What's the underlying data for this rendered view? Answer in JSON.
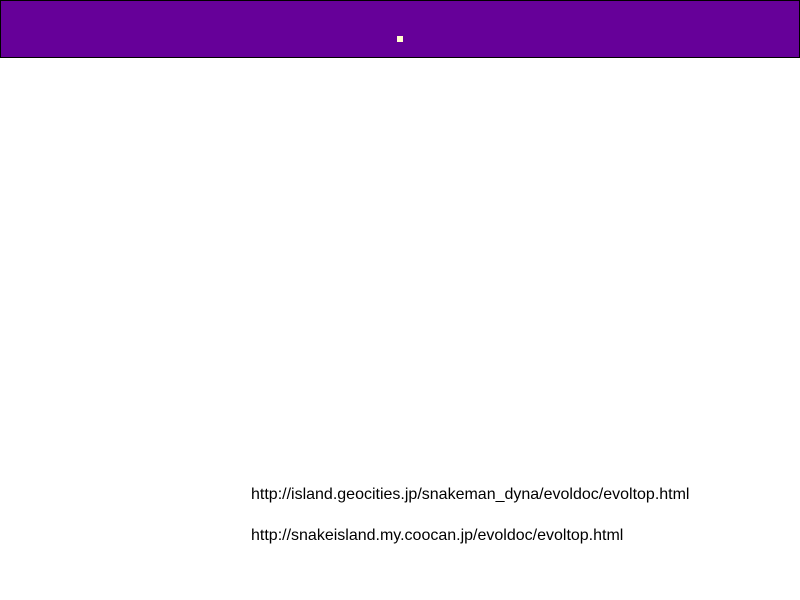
{
  "header": {
    "background_color": "#660099",
    "dot_color": "#ffffcc"
  },
  "links": [
    "http://island.geocities.jp/snakeman_dyna/evoldoc/evoltop.html",
    "http://snakeisland.my.coocan.jp/evoldoc/evoltop.html"
  ]
}
